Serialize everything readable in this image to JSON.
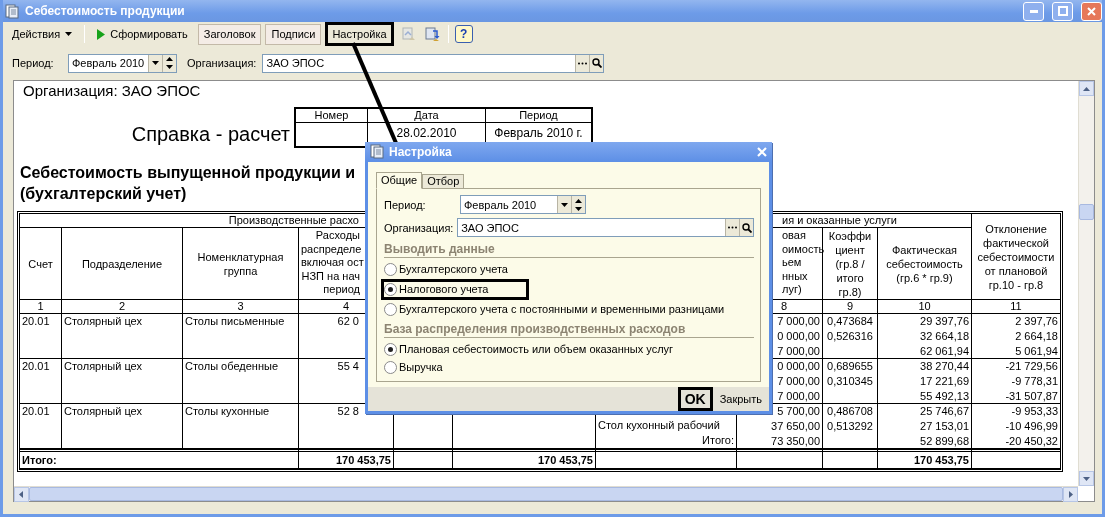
{
  "window": {
    "title": "Себестоимость продукции"
  },
  "toolbar": [
    {
      "kind": "menu",
      "label": "Действия"
    },
    {
      "kind": "run",
      "label": "Сформировать"
    },
    {
      "kind": "toggle",
      "label": "Заголовок",
      "pressed": true,
      "highlighted": false
    },
    {
      "kind": "toggle",
      "label": "Подписи",
      "pressed": true,
      "highlighted": false
    },
    {
      "kind": "toggle",
      "label": "Настройка",
      "pressed": false,
      "highlighted": true
    },
    {
      "kind": "icon",
      "disabled": true
    },
    {
      "kind": "icon",
      "disabled": false
    },
    {
      "kind": "help",
      "label": "?"
    }
  ],
  "filters": {
    "period": {
      "label": "Период:",
      "value": "Февраль 2010"
    },
    "organization": {
      "label": "Организация:",
      "value": "ЗАО ЭПОС"
    }
  },
  "report": {
    "organization": "Организация: ЗАО ЭПОС",
    "doc_title": "Справка - расчет",
    "doc_table": [
      {
        "heading": "Номер"
      },
      {
        "heading": "Дата",
        "value": "28.02.2010"
      },
      {
        "heading": "Период",
        "value": "Февраль 2010 г."
      }
    ],
    "heading_lines": [
      "Себестоимость выпущенной продукции и",
      "(бухгалтерский учет)"
    ],
    "table": {
      "group_headers": [
        "Производственные расхо",
        "ия и оказанные услуги"
      ],
      "left_columns": [
        {
          "heading": "Счет",
          "number": "1"
        },
        {
          "heading": "Подразделение",
          "number": "2"
        },
        {
          "heading": "Номенклатурная\nгруппа",
          "number": "3"
        },
        {
          "heading": "Расходы\nраспределе\nвключая ост\nНЗП на нач\nпериод",
          "number": "4"
        }
      ],
      "right_columns": [
        {
          "heading": "овая\nоимость\nьем\nнных\nлуг)",
          "number": "8"
        },
        {
          "heading": "Коэффи\nциент\n(гр.8 /\nитого\nгр.8)",
          "number": "9"
        },
        {
          "heading": "Фактическая\nсебестоимость\n(гр.6 * гр.9)",
          "number": "10"
        },
        {
          "heading": "Отклонение\nфактической\nсебестоимости\nот плановой\nгр.10 - гр.8",
          "number": "11"
        }
      ],
      "rows": [
        {
          "account": "20.01",
          "department": "Столярный цех",
          "group": "Столы письменные",
          "amount": "62 0",
          "lines": [
            {
              "kind": "item",
              "cost": "7 000,00",
              "coefficient": "0,473684",
              "actual": "29 397,76",
              "deviation": "2 397,76"
            },
            {
              "kind": "item",
              "cost": "0 000,00",
              "coefficient": "0,526316",
              "actual": "32 664,18",
              "deviation": "2 664,18"
            },
            {
              "kind": "total",
              "cost": "7 000,00",
              "actual": "62 061,94",
              "deviation": "5 061,94"
            }
          ]
        },
        {
          "account": "20.01",
          "department": "Столярный цех",
          "group": "Столы обеденные",
          "amount": "55 4",
          "lines": [
            {
              "kind": "item",
              "cost": "0 000,00",
              "coefficient": "0,689655",
              "actual": "38 270,44",
              "deviation": "-21 729,56"
            },
            {
              "kind": "item",
              "cost": "7 000,00",
              "coefficient": "0,310345",
              "actual": "17 221,69",
              "deviation": "-9 778,31"
            },
            {
              "kind": "total",
              "cost": "7 000,00",
              "actual": "55 492,13",
              "deviation": "-31 507,87"
            }
          ]
        },
        {
          "account": "20.01",
          "department": "Столярный цех",
          "group": "Столы кухонные",
          "amount": "52 8",
          "lines": [
            {
              "kind": "item",
              "cost": "5 700,00",
              "coefficient": "0,486708",
              "actual": "25 746,67",
              "deviation": "-9 953,33"
            },
            {
              "kind": "item",
              "name": "Стол кухонный рабочий",
              "cost": "37 650,00",
              "coefficient": "0,513292",
              "actual": "27 153,01",
              "deviation": "-10 496,99"
            },
            {
              "kind": "total",
              "name": "Итого:",
              "cost": "73 350,00",
              "actual": "52 899,68",
              "deviation": "-20 450,32"
            }
          ]
        }
      ],
      "total": {
        "label": "Итого:",
        "amount": "170 453,75",
        "column_6": "170 453,75",
        "actual": "170 453,75"
      }
    }
  },
  "dialog": {
    "title": "Настройка",
    "tabs": [
      {
        "label": "Общие",
        "selected": true
      },
      {
        "label": "Отбор",
        "selected": false
      }
    ],
    "fields": {
      "period": {
        "label": "Период:",
        "value": "Февраль 2010"
      },
      "organization": {
        "label": "Организация:",
        "value": "ЗАО ЭПОС"
      }
    },
    "sections": [
      {
        "title": "Выводить данные",
        "options": [
          {
            "label": "Бухгалтерского учета",
            "selected": false,
            "highlighted": false
          },
          {
            "label": "Налогового учета",
            "selected": true,
            "highlighted": true
          },
          {
            "label": "Бухгалтерского учета с постоянными и временными разницами",
            "selected": false,
            "highlighted": false
          }
        ]
      },
      {
        "title": "База распределения производственных расходов",
        "options": [
          {
            "label": "Плановая себестоимость или объем оказанных услуг",
            "selected": true,
            "highlighted": false
          },
          {
            "label": "Выручка",
            "selected": false,
            "highlighted": false
          }
        ]
      }
    ],
    "buttons": [
      {
        "label": "OK",
        "highlighted": true
      },
      {
        "label": "Закрыть",
        "highlighted": false
      }
    ]
  }
}
